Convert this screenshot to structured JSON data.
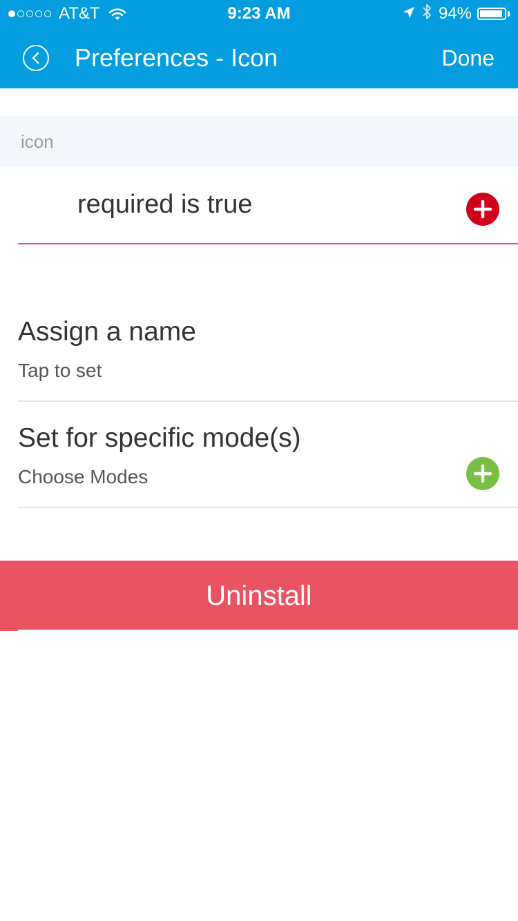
{
  "status_bar": {
    "carrier": "AT&T",
    "time": "9:23 AM",
    "battery_percent": "94%",
    "battery_level": 0.94,
    "signal_bars_filled": 1,
    "signal_bars_total": 5
  },
  "nav": {
    "title": "Preferences - Icon",
    "done_label": "Done"
  },
  "section": {
    "header": "icon"
  },
  "required_row": {
    "text": "required is true",
    "add_icon": "plus-circle-icon"
  },
  "rows": [
    {
      "title": "Assign a name",
      "subtitle": "Tap to set"
    },
    {
      "title": "Set for specific mode(s)",
      "subtitle": "Choose Modes",
      "add_icon": "plus-circle-icon"
    }
  ],
  "uninstall_label": "Uninstall",
  "colors": {
    "header": "#039de0",
    "section_bg": "#f4f7fc",
    "required_add": "#d0021b",
    "modes_add": "#78c043",
    "uninstall": "#e95362",
    "error_line": "#e0525f"
  }
}
